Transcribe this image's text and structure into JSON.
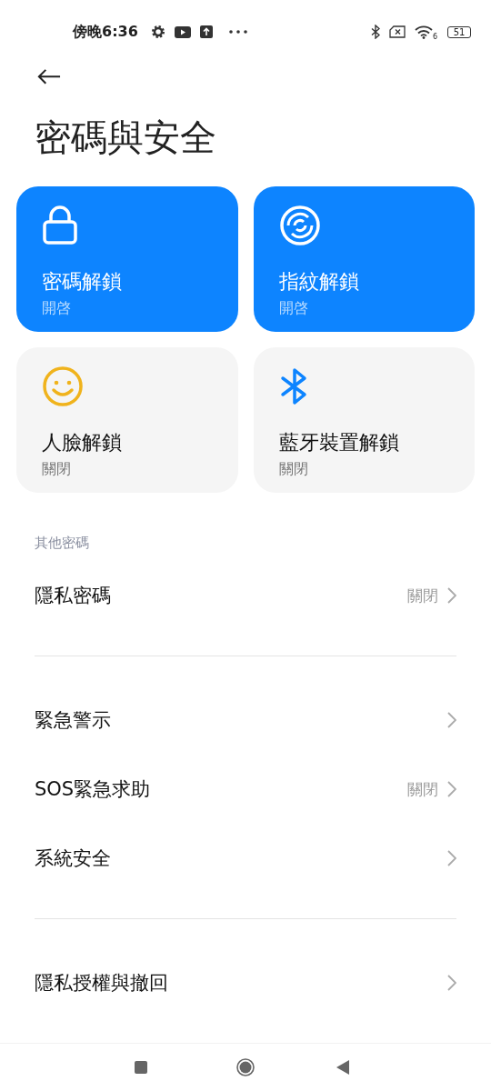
{
  "status_bar": {
    "time": "傍晚6:36",
    "wifi_badge": "6",
    "battery": "51"
  },
  "title": "密碼與安全",
  "tiles": [
    {
      "kind": "lock",
      "title": "密碼解鎖",
      "status": "開啓",
      "on": true
    },
    {
      "kind": "fingerprint",
      "title": "指紋解鎖",
      "status": "開啓",
      "on": true
    },
    {
      "kind": "face",
      "title": "人臉解鎖",
      "status": "關閉",
      "on": false
    },
    {
      "kind": "bluetooth",
      "title": "藍牙裝置解鎖",
      "status": "關閉",
      "on": false
    }
  ],
  "sections": [
    {
      "label": "其他密碼",
      "items": [
        {
          "label": "隱私密碼",
          "value": "關閉"
        }
      ]
    },
    {
      "items": [
        {
          "label": "緊急警示"
        },
        {
          "label": "SOS緊急求助",
          "value": "關閉"
        },
        {
          "label": "系統安全"
        }
      ]
    },
    {
      "items": [
        {
          "label": "隱私授權與撤回"
        }
      ]
    }
  ]
}
